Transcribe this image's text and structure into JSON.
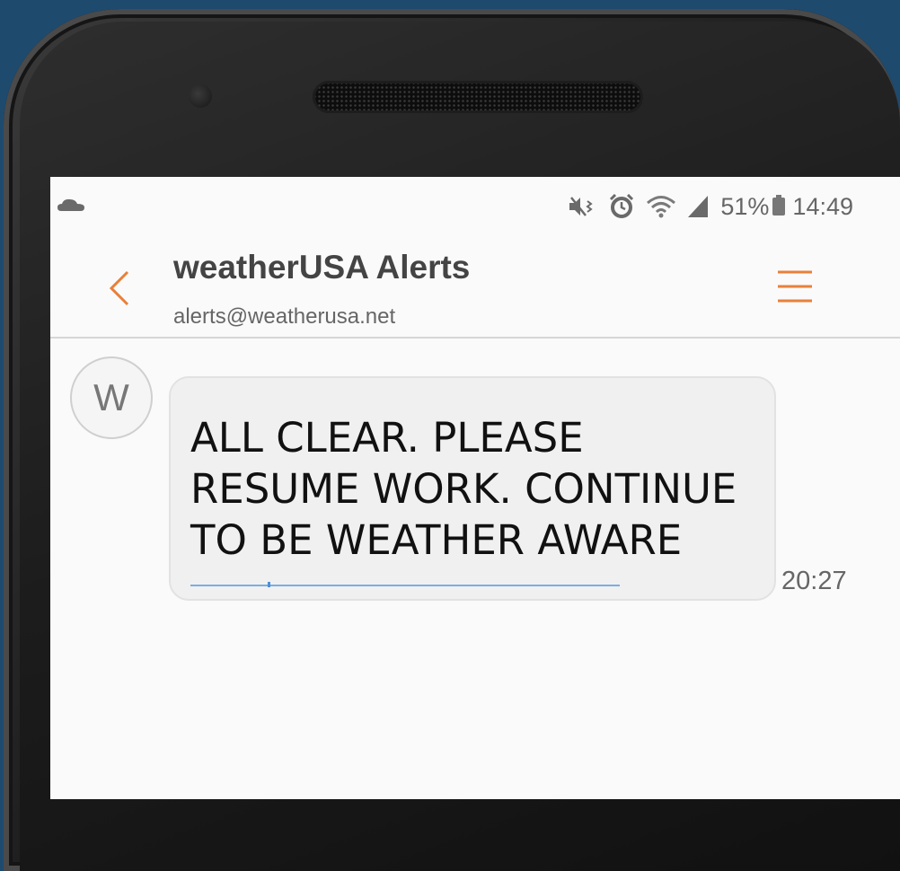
{
  "status_bar": {
    "battery_percent": "51%",
    "time": "14:49",
    "icons": [
      "cloud-icon",
      "mute-vibrate-icon",
      "alarm-icon",
      "wifi-icon",
      "signal-icon",
      "battery-icon"
    ]
  },
  "header": {
    "sender_name": "weatherUSA Alerts",
    "sender_email": "alerts@weatherusa.net",
    "accent_color": "#e8803a"
  },
  "message": {
    "avatar_letter": "W",
    "text": "ALL CLEAR. PLEASE RESUME WORK. CONTINUE TO BE WEATHER AWARE",
    "time": "20:27"
  }
}
